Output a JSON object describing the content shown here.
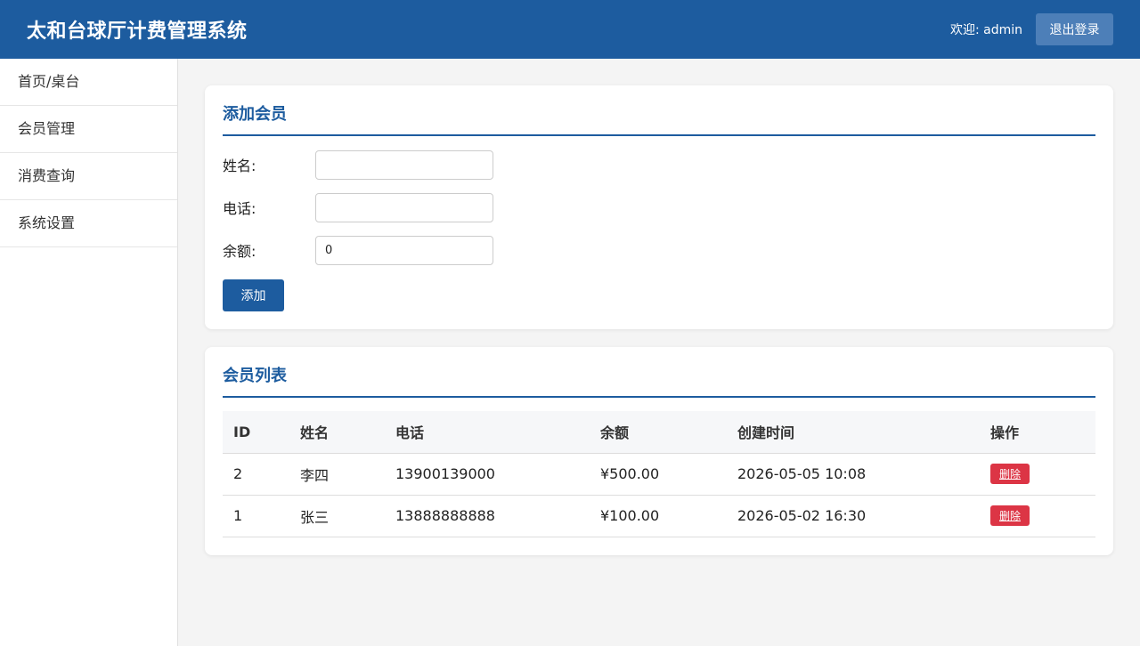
{
  "header": {
    "title": "太和台球厅计费管理系统",
    "welcome": "欢迎: admin",
    "logout_label": "退出登录"
  },
  "sidebar": {
    "items": [
      {
        "label": "首页/桌台"
      },
      {
        "label": "会员管理"
      },
      {
        "label": "消费查询"
      },
      {
        "label": "系统设置"
      }
    ]
  },
  "add_member": {
    "title": "添加会员",
    "name_label": "姓名:",
    "name_value": "",
    "phone_label": "电话:",
    "phone_value": "",
    "balance_label": "余额:",
    "balance_value": "0",
    "submit_label": "添加"
  },
  "member_list": {
    "title": "会员列表",
    "columns": [
      "ID",
      "姓名",
      "电话",
      "余额",
      "创建时间",
      "操作"
    ],
    "rows": [
      {
        "id": "2",
        "name": "李四",
        "phone": "13900139000",
        "balance": "¥500.00",
        "created": "2026-05-05 10:08",
        "action": "删除"
      },
      {
        "id": "1",
        "name": "张三",
        "phone": "13888888888",
        "balance": "¥100.00",
        "created": "2026-05-02 16:30",
        "action": "删除"
      }
    ]
  },
  "colors": {
    "primary": "#1d5c9f",
    "danger": "#dc3545",
    "background": "#f4f4f4"
  }
}
